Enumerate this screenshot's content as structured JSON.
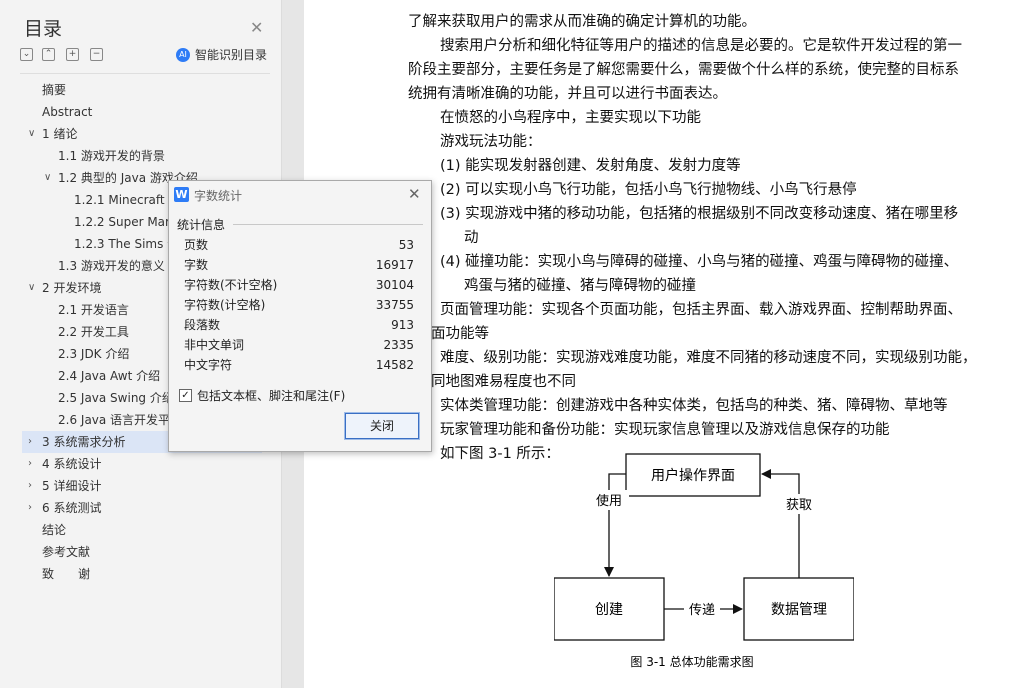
{
  "toc": {
    "title": "目录",
    "smart_toc_label": "智能识别目录",
    "toolbar_icons": [
      "collapse-all-icon",
      "expand-icon",
      "add-icon",
      "remove-icon"
    ],
    "items": [
      {
        "label": "摘要",
        "level": 0,
        "chevron": ""
      },
      {
        "label": "Abstract",
        "level": 0,
        "chevron": ""
      },
      {
        "label": "1 绪论",
        "level": 0,
        "chevron": "down"
      },
      {
        "label": "1.1 游戏开发的背景",
        "level": 1,
        "chevron": ""
      },
      {
        "label": "1.2 典型的 Java 游戏介绍",
        "level": 1,
        "chevron": "down"
      },
      {
        "label": "1.2.1 Minecraft 介绍",
        "level": 2,
        "chevron": ""
      },
      {
        "label": "1.2.2 Super Mario 介绍",
        "level": 2,
        "chevron": ""
      },
      {
        "label": "1.2.3 The Sims 介绍",
        "level": 2,
        "chevron": ""
      },
      {
        "label": "1.3 游戏开发的意义",
        "level": 1,
        "chevron": ""
      },
      {
        "label": "2 开发环境",
        "level": 0,
        "chevron": "down"
      },
      {
        "label": "2.1 开发语言",
        "level": 1,
        "chevron": ""
      },
      {
        "label": "2.2 开发工具",
        "level": 1,
        "chevron": ""
      },
      {
        "label": "2.3 JDK 介绍",
        "level": 1,
        "chevron": ""
      },
      {
        "label": "2.4 Java Awt 介绍",
        "level": 1,
        "chevron": ""
      },
      {
        "label": "2.5 Java Swing 介绍",
        "level": 1,
        "chevron": ""
      },
      {
        "label": "2.6 Java 语言开发平台",
        "level": 1,
        "chevron": ""
      },
      {
        "label": "3 系统需求分析",
        "level": 0,
        "chevron": "right",
        "selected": true
      },
      {
        "label": "4 系统设计",
        "level": 0,
        "chevron": "right"
      },
      {
        "label": "5 详细设计",
        "level": 0,
        "chevron": "right"
      },
      {
        "label": "6 系统测试",
        "level": 0,
        "chevron": "right"
      },
      {
        "label": "结论",
        "level": 0,
        "chevron": ""
      },
      {
        "label": "参考文献",
        "level": 0,
        "chevron": ""
      },
      {
        "label": "致　　谢",
        "level": 0,
        "chevron": ""
      }
    ]
  },
  "document": {
    "lines": [
      {
        "text": "了解来获取用户的需求从而准确的确定计算机的功能。",
        "indent": 0
      },
      {
        "text": "搜索用户分析和细化特征等用户的描述的信息是必要的。它是软件开发过程的第一",
        "indent": 32
      },
      {
        "text": "阶段主要部分，主要任务是了解您需要什么，需要做个什么样的系统，使完整的目标系",
        "indent": 0
      },
      {
        "text": "统拥有清晰准确的功能，并且可以进行书面表达。",
        "indent": 0
      },
      {
        "text": "在愤怒的小鸟程序中，主要实现以下功能",
        "indent": 32
      },
      {
        "text": "游戏玩法功能：",
        "indent": 32
      },
      {
        "text": "(1) 能实现发射器创建、发射角度、发射力度等",
        "indent": 32
      },
      {
        "text": "(2) 可以实现小鸟飞行功能，包括小鸟飞行抛物线、小鸟飞行悬停",
        "indent": 32
      },
      {
        "text": "(3) 实现游戏中猪的移动功能，包括猪的根据级别不同改变移动速度、猪在哪里移",
        "indent": 32
      },
      {
        "text": "动",
        "indent": 56
      },
      {
        "text": "(4) 碰撞功能：实现小鸟与障碍的碰撞、小鸟与猪的碰撞、鸡蛋与障碍物的碰撞、",
        "indent": 32
      },
      {
        "text": "鸡蛋与猪的碰撞、猪与障碍物的碰撞",
        "indent": 56
      },
      {
        "text": "页面管理功能：实现各个页面功能，包括主界面、载入游戏界面、控制帮助界面、",
        "indent": 32
      },
      {
        "text": "转界面功能等",
        "indent": 0
      },
      {
        "text": "难度、级别功能：实现游戏难度功能，难度不同猪的移动速度不同，实现级别功能，",
        "indent": 32
      },
      {
        "text": "别不同地图难易程度也不同",
        "indent": 0
      },
      {
        "text": "实体类管理功能：创建游戏中各种实体类，包括鸟的种类、猪、障碍物、草地等",
        "indent": 32
      },
      {
        "text": "玩家管理功能和备份功能：实现玩家信息管理以及游戏信息保存的功能",
        "indent": 32
      },
      {
        "text": "如下图 3-1 所示：",
        "indent": 32
      }
    ],
    "diagram": {
      "top_box": "用户操作界面",
      "left_box": "创建",
      "right_box": "数据管理",
      "label_left": "使用",
      "label_right": "获取",
      "label_bottom": "传递",
      "caption": "图 3-1  总体功能需求图"
    }
  },
  "dialog": {
    "title": "字数统计",
    "section": "统计信息",
    "stats": [
      {
        "label": "页数",
        "value": "53"
      },
      {
        "label": "字数",
        "value": "16917"
      },
      {
        "label": "字符数(不计空格)",
        "value": "30104"
      },
      {
        "label": "字符数(计空格)",
        "value": "33755"
      },
      {
        "label": "段落数",
        "value": "913"
      },
      {
        "label": "非中文单词",
        "value": "2335"
      },
      {
        "label": "中文字符",
        "value": "14582"
      }
    ],
    "checkbox_label": "包括文本框、脚注和尾注(F)",
    "checkbox_checked": true,
    "close_button": "关闭"
  },
  "colors": {
    "selection": "#dbe5f6",
    "accent": "#2e7cf6",
    "panel_bg": "#f3f3f3"
  }
}
